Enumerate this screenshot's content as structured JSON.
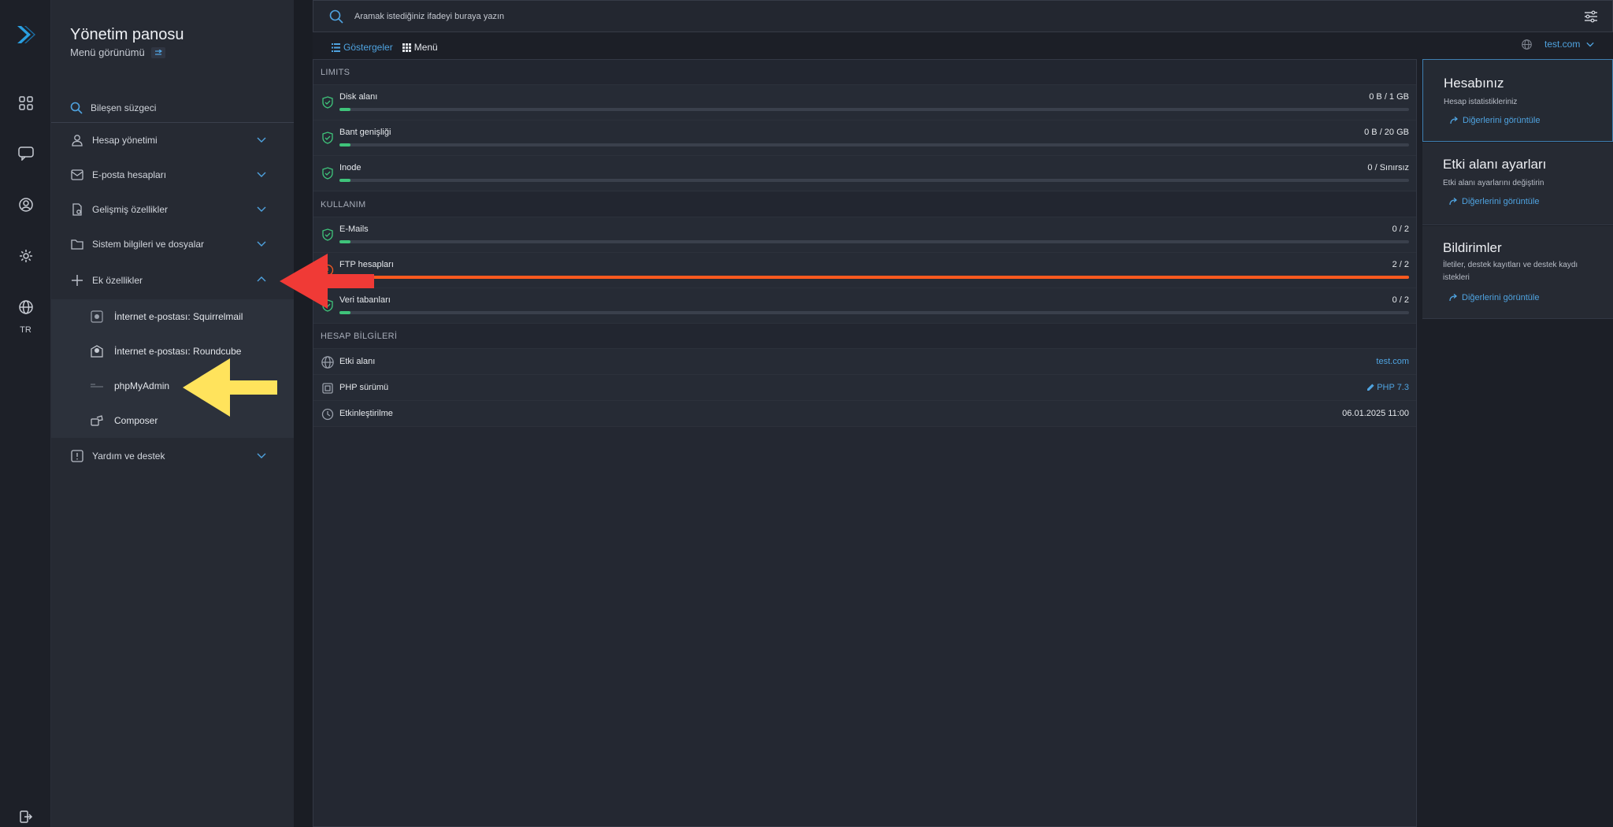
{
  "rail": {
    "items": [
      "dashboard-icon",
      "chat-icon",
      "user-circle-icon",
      "gear-icon",
      "globe-icon"
    ],
    "language": "TR",
    "logout_icon": "logout-icon",
    "accent": "#2a9fe0"
  },
  "sidebar": {
    "title": "Yönetim panosu",
    "subtitle": "Menü görünümü",
    "filter_label": "Bileşen süzgeci",
    "items": [
      {
        "label": "Hesap yönetimi",
        "icon": "user-icon",
        "expanded": false
      },
      {
        "label": "E-posta hesapları",
        "icon": "mail-icon",
        "expanded": false
      },
      {
        "label": "Gelişmiş özellikler",
        "icon": "advanced-file-icon",
        "expanded": false
      },
      {
        "label": "Sistem bilgileri ve dosyalar",
        "icon": "folder-icon",
        "expanded": false
      },
      {
        "label": "Ek özellikler",
        "icon": "plus-icon",
        "expanded": true
      },
      {
        "label": "Yardım ve destek",
        "icon": "alert-icon",
        "expanded": false
      }
    ],
    "subitems": [
      {
        "label": "İnternet e-postası: Squirrelmail",
        "icon": "squirrelmail-icon"
      },
      {
        "label": "İnternet e-postası: Roundcube",
        "icon": "roundcube-icon"
      },
      {
        "label": "phpMyAdmin",
        "icon": "phpmyadmin-icon"
      },
      {
        "label": "Composer",
        "icon": "composer-icon"
      }
    ]
  },
  "search": {
    "placeholder": "Aramak istediğiniz ifadeyi buraya yazın"
  },
  "view_tabs": [
    {
      "label": "Göstergeler",
      "active": true
    },
    {
      "label": "Menü",
      "active": false
    }
  ],
  "domain_selector": "test.com",
  "stats": {
    "limits_header": "LIMITS",
    "limits": [
      {
        "label": "Disk alanı",
        "value": "0 B / 1 GB",
        "fill": 0.01,
        "status": "ok"
      },
      {
        "label": "Bant genişliği",
        "value": "0 B / 20 GB",
        "fill": 0.01,
        "status": "ok"
      },
      {
        "label": "Inode",
        "value": "0 / Sınırsız",
        "fill": 0.01,
        "status": "ok"
      }
    ],
    "usage_header": "KULLANIM",
    "usage": [
      {
        "label": "E-Mails",
        "value": "0 / 2",
        "fill": 0.01,
        "status": "ok"
      },
      {
        "label": "FTP hesapları",
        "value": "2 / 2",
        "fill": 1.0,
        "status": "full"
      },
      {
        "label": "Veri tabanları",
        "value": "0 / 2",
        "fill": 0.01,
        "status": "ok"
      }
    ],
    "account_header": "HESAP BİLGİLERİ",
    "account": [
      {
        "label": "Etki alanı",
        "value": "test.com",
        "icon": "globe-icon"
      },
      {
        "label": "PHP sürümü",
        "value": "PHP 7.3",
        "icon": "chip-icon"
      },
      {
        "label": "Etkinleştirilme",
        "value": "06.01.2025 11:00",
        "icon": "clock-icon"
      }
    ]
  },
  "cards": [
    {
      "title": "Hesabınız",
      "subtitle": "Hesap istatistikleriniz",
      "link": "Diğerlerini görüntüle"
    },
    {
      "title": "Etki alanı ayarları",
      "subtitle": "Etki alanı ayarlarını değiştirin",
      "link": "Diğerlerini görüntüle"
    },
    {
      "title": "Bildirimler",
      "subtitle": "İletiler, destek kayıtları ve destek kaydı istekleri",
      "link": "Diğerlerini görüntüle"
    }
  ],
  "colors": {
    "accent": "#4fa3e0",
    "ok_green": "#3fc37a",
    "full_orange": "#ff5a1f",
    "annotation_red": "#f03a36",
    "annotation_yellow": "#ffe35c"
  }
}
